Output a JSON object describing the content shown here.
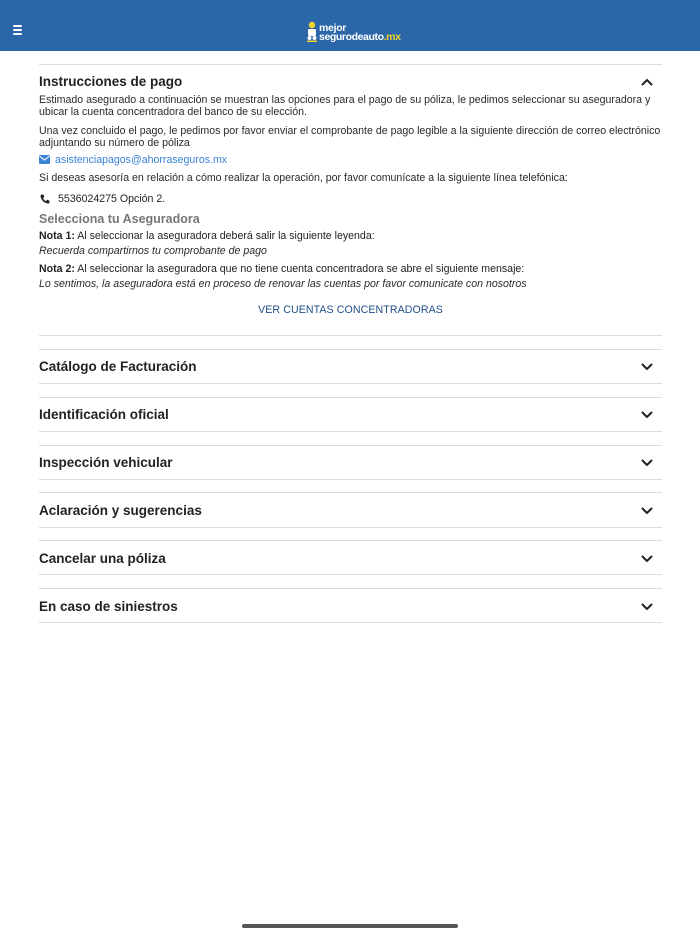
{
  "header": {
    "menu_icon": "hamburger-menu-icon",
    "logo_line1": "mejor",
    "logo_line2_main": "segurodeauto",
    "logo_line2_tld": ".mx",
    "colors": {
      "bar": "#2b67a8",
      "logo_accent": "#f4d42a"
    }
  },
  "payment": {
    "title": "Instrucciones de pago",
    "expanded": true,
    "p1": "Estimado asegurado a continuación se muestran las opciones para el pago de su póliza, le pedimos seleccionar su aseguradora y ubicar la cuenta concentradora del banco de su elección.",
    "p2": "Una vez concluido el pago, le pedimos por favor enviar el comprobante de pago legible a la siguiente dirección de correo electrónico adjuntando su número de póliza",
    "email": "asistenciapagos@ahorraseguros.mx",
    "p3": "Si deseas asesoría en relación a cómo realizar la operación, por favor comunícate a la siguiente línea telefónica:",
    "phone": "5536024275  Opción 2.",
    "select_title": "Selecciona tu Aseguradora",
    "note1_label": "Nota 1:",
    "note1_text": " Al seleccionar la aseguradora deberá salir la siguiente leyenda:",
    "note1_quote": "Recuerda compartirnos tu comprobante de pago",
    "note2_label": "Nota 2:",
    "note2_text": " Al seleccionar la aseguradora que no tiene cuenta concentradora se abre el siguiente mensaje:",
    "note2_quote": "Lo sentimos, la aseguradora está en proceso de renovar las cuentas por favor comunicate con nosotros",
    "button": "VER CUENTAS CONCENTRADORAS",
    "colors": {
      "link": "#3a82d6",
      "button_text": "#1f4e86",
      "subtitle": "#777777"
    }
  },
  "sections": [
    {
      "title": "Catálogo de Facturación",
      "expanded": false
    },
    {
      "title": "Identificación oficial",
      "expanded": false
    },
    {
      "title": "Inspección vehicular",
      "expanded": false
    },
    {
      "title": "Aclaración y sugerencias",
      "expanded": false
    },
    {
      "title": "Cancelar una póliza",
      "expanded": false
    },
    {
      "title": "En caso de siniestros",
      "expanded": false
    }
  ]
}
